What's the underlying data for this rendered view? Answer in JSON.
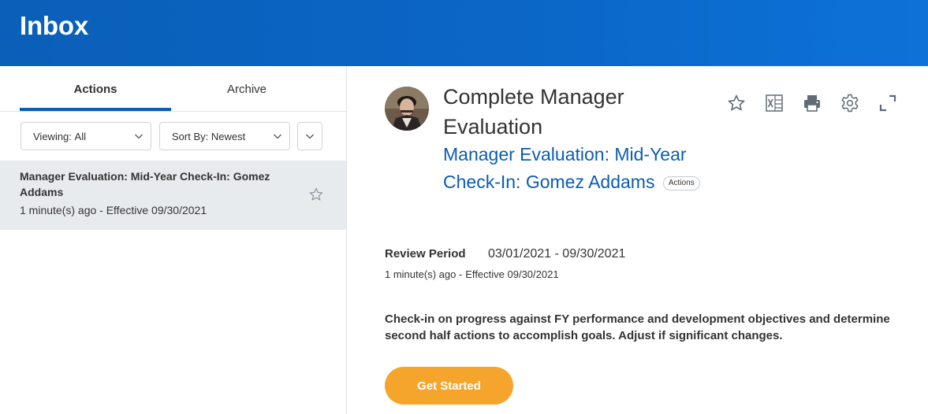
{
  "header": {
    "title": "Inbox"
  },
  "tabs": [
    {
      "label": "Actions",
      "selected": true
    },
    {
      "label": "Archive",
      "selected": false
    }
  ],
  "filters": {
    "viewing": {
      "prefix": "Viewing:",
      "value": "All"
    },
    "sort": {
      "prefix": "Sort By:",
      "value": "Newest"
    }
  },
  "inbox_items": [
    {
      "title": "Manager Evaluation: Mid-Year Check-In: Gomez Addams",
      "meta": "1 minute(s) ago - Effective 09/30/2021",
      "starred": false
    }
  ],
  "detail": {
    "title": "Complete Manager Evaluation",
    "link": "Manager Evaluation: Mid-Year Check-In: Gomez Addams",
    "badge": "Actions",
    "review_period_label": "Review Period",
    "review_period_value": "03/01/2021 - 09/30/2021",
    "time_ago": "1 minute(s) ago -",
    "effective": "Effective 09/30/2021",
    "description": "Check-in on progress against FY performance and development objectives and determine second half actions to accomplish goals. Adjust if significant changes.",
    "cta_label": "Get Started",
    "toolbar_icons": [
      "star-icon",
      "excel-export-icon",
      "print-icon",
      "gear-icon",
      "expand-icon"
    ]
  },
  "colors": {
    "header_bg": "#0b66c6",
    "link": "#0b5cb5",
    "tab_underline": "#0b5cb5",
    "selected_item_bg": "#e8ebee",
    "cta_bg": "#f5a52b"
  }
}
